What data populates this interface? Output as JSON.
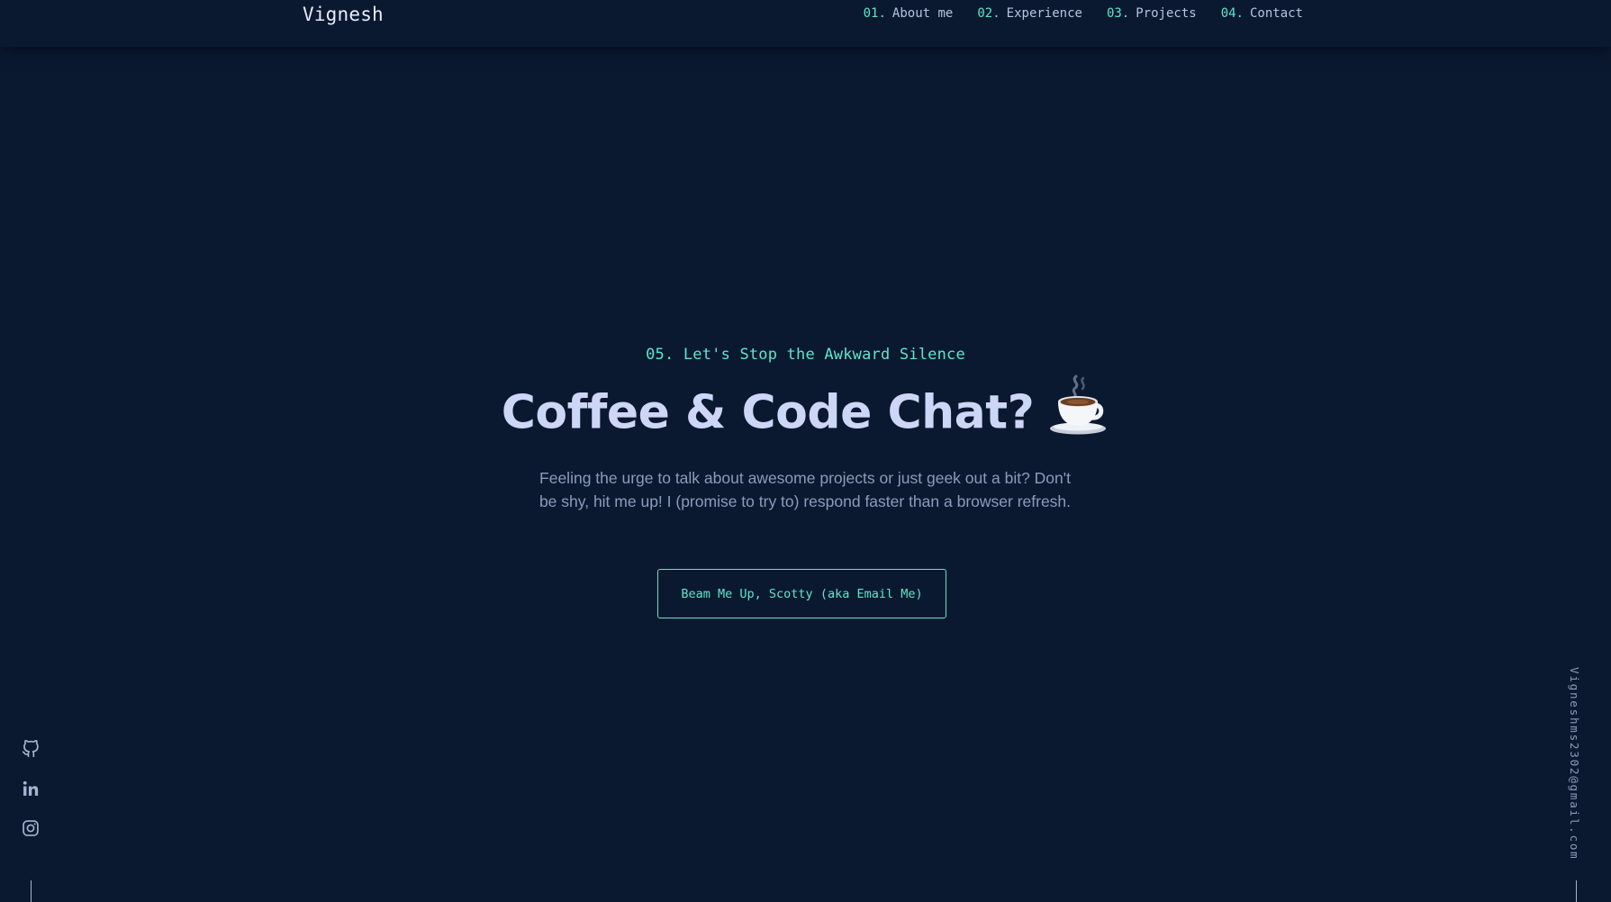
{
  "header": {
    "logo": "Vignesh",
    "nav": [
      {
        "num": "01.",
        "label": "About me"
      },
      {
        "num": "02.",
        "label": "Experience"
      },
      {
        "num": "03.",
        "label": "Projects"
      },
      {
        "num": "04.",
        "label": "Contact"
      }
    ]
  },
  "contact": {
    "overline": "05. Let's Stop the Awkward Silence",
    "title": "Coffee & Code Chat?",
    "title_emoji": "coffee-cup-icon",
    "blurb": "Feeling the urge to talk about awesome projects or just geek out a bit? Don't be shy, hit me up! I (promise to try to) respond faster than a browser refresh.",
    "cta_label": "Beam Me Up, Scotty (aka Email Me)"
  },
  "sidebar_left": {
    "icons": [
      "github-icon",
      "linkedin-icon",
      "instagram-icon"
    ]
  },
  "sidebar_right": {
    "email": "Vigneshms2302@gmail.com"
  },
  "colors": {
    "background": "#0b1930",
    "accent": "#5ee6c9",
    "heading": "#cdd6f6",
    "body_text": "#8c9bbd"
  }
}
